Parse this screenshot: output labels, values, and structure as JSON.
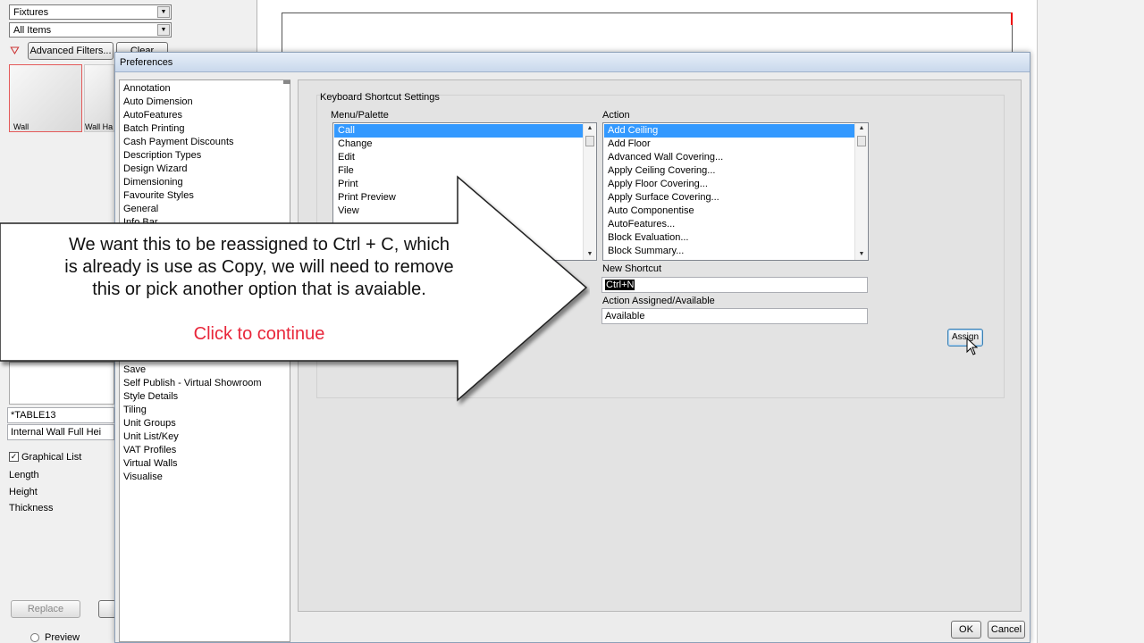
{
  "background": {
    "combo_category": "Fixtures",
    "combo_filter": "All Items",
    "advanced_filters_label": "Advanced Filters...",
    "clear_label": "Clear",
    "thumbnails": [
      "Wall",
      "Wall Ha"
    ],
    "table_code": "*TABLE13",
    "item_desc": "Internal Wall Full Hei",
    "graphical_list_label": "Graphical List",
    "props": [
      "Length",
      "Height",
      "Thickness"
    ],
    "replace_label": "Replace",
    "preview_label": "Preview"
  },
  "dialog": {
    "title": "Preferences",
    "categories_top": [
      "Annotation",
      "Auto Dimension",
      "AutoFeatures",
      "Batch Printing",
      "Cash Payment Discounts",
      "Description Types",
      "Design Wizard",
      "Dimensioning",
      "Favourite Styles",
      "General",
      "Info Bar"
    ],
    "categories_bottom": [
      "Save",
      "Self Publish - Virtual Showroom",
      "Style Details",
      "Tiling",
      "Unit Groups",
      "Unit List/Key",
      "VAT Profiles",
      "Virtual Walls",
      "Visualise"
    ],
    "group_title": "Keyboard Shortcut Settings",
    "menu_label": "Menu/Palette",
    "menu_items": [
      "Call",
      "Change",
      "Edit",
      "File",
      "Print",
      "Print Preview",
      "View"
    ],
    "action_label": "Action",
    "action_items": [
      "Add Ceiling",
      "Add Floor",
      "Advanced Wall Covering...",
      "Apply Ceiling Covering...",
      "Apply Floor Covering...",
      "Apply Surface Covering...",
      "Auto Componentise",
      "AutoFeatures...",
      "Block Evaluation...",
      "Block Summary..."
    ],
    "new_shortcut_label": "New Shortcut",
    "new_shortcut_value": "Ctrl+N",
    "assigned_label": "Action Assigned/Available",
    "assigned_value": "Available",
    "assign_label": "Assign",
    "ok_label": "OK",
    "cancel_label": "Cancel"
  },
  "callout": {
    "line1": "We want this to be reassigned to Ctrl + C, which",
    "line2": "is already is use as Copy, we will need to remove",
    "line3": "this or pick another option that is avaiable.",
    "cta": "Click to continue",
    "cta_color": "#e8263a"
  }
}
